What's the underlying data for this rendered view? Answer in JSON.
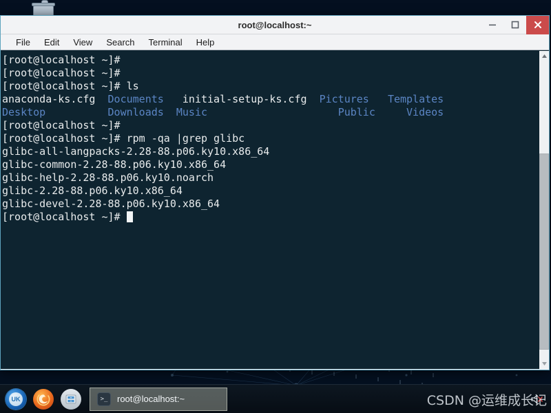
{
  "desktop": {
    "trash": {
      "label": "Trash",
      "icon": "trash-icon"
    },
    "wallpaper_color": "#0a3a74"
  },
  "window": {
    "title": "root@localhost:~",
    "controls": {
      "minimize": "–",
      "maximize": "☐",
      "close": "✕"
    },
    "close_color": "#cb4b4b",
    "menus": [
      {
        "label": "File"
      },
      {
        "label": "Edit"
      },
      {
        "label": "View"
      },
      {
        "label": "Search"
      },
      {
        "label": "Terminal"
      },
      {
        "label": "Help"
      }
    ]
  },
  "terminal": {
    "background": "#0e2430",
    "foreground": "#e6e9ea",
    "dir_color": "#5b85c4",
    "prompt": "[root@localhost ~]#",
    "lines": [
      {
        "segments": [
          {
            "text": "[root@localhost ~]#",
            "color": "default"
          }
        ]
      },
      {
        "segments": [
          {
            "text": "[root@localhost ~]#",
            "color": "default"
          }
        ]
      },
      {
        "segments": [
          {
            "text": "[root@localhost ~]# ls",
            "color": "default"
          }
        ]
      },
      {
        "segments": [
          {
            "text": "anaconda-ks.cfg  ",
            "color": "default"
          },
          {
            "text": "Documents",
            "color": "dir"
          },
          {
            "text": "   initial-setup-ks.cfg  ",
            "color": "default"
          },
          {
            "text": "Pictures",
            "color": "dir"
          },
          {
            "text": "   ",
            "color": "default"
          },
          {
            "text": "Templates",
            "color": "dir"
          }
        ]
      },
      {
        "segments": [
          {
            "text": "Desktop",
            "color": "dir"
          },
          {
            "text": "          ",
            "color": "default"
          },
          {
            "text": "Downloads",
            "color": "dir"
          },
          {
            "text": "  ",
            "color": "default"
          },
          {
            "text": "Music",
            "color": "dir"
          },
          {
            "text": "                     ",
            "color": "default"
          },
          {
            "text": "Public",
            "color": "dir"
          },
          {
            "text": "     ",
            "color": "default"
          },
          {
            "text": "Videos",
            "color": "dir"
          }
        ]
      },
      {
        "segments": [
          {
            "text": "[root@localhost ~]#",
            "color": "default"
          }
        ]
      },
      {
        "segments": [
          {
            "text": "[root@localhost ~]# rpm -qa |grep glibc",
            "color": "default"
          }
        ]
      },
      {
        "segments": [
          {
            "text": "glibc-all-langpacks-2.28-88.p06.ky10.x86_64",
            "color": "default"
          }
        ]
      },
      {
        "segments": [
          {
            "text": "glibc-common-2.28-88.p06.ky10.x86_64",
            "color": "default"
          }
        ]
      },
      {
        "segments": [
          {
            "text": "glibc-help-2.28-88.p06.ky10.noarch",
            "color": "default"
          }
        ]
      },
      {
        "segments": [
          {
            "text": "glibc-2.28-88.p06.ky10.x86_64",
            "color": "default"
          }
        ]
      },
      {
        "segments": [
          {
            "text": "glibc-devel-2.28-88.p06.ky10.x86_64",
            "color": "default"
          }
        ]
      },
      {
        "segments": [
          {
            "text": "[root@localhost ~]# ",
            "color": "default"
          }
        ],
        "cursor": true
      }
    ],
    "scrollbar": {
      "up_arrow": "▲",
      "down_arrow": "▼"
    }
  },
  "taskbar": {
    "launchers": [
      {
        "name": "kylin-start-icon",
        "label": "UK"
      },
      {
        "name": "firefox-icon",
        "label": ""
      },
      {
        "name": "file-manager-icon",
        "label": ""
      }
    ],
    "window_buttons": [
      {
        "icon": "terminal-icon",
        "glyph": ">_",
        "label": "root@localhost:~"
      }
    ],
    "tray": [
      {
        "name": "display-icon"
      },
      {
        "name": "volume-muted-icon"
      }
    ]
  },
  "watermark": {
    "text": "CSDN @运维成长记"
  }
}
